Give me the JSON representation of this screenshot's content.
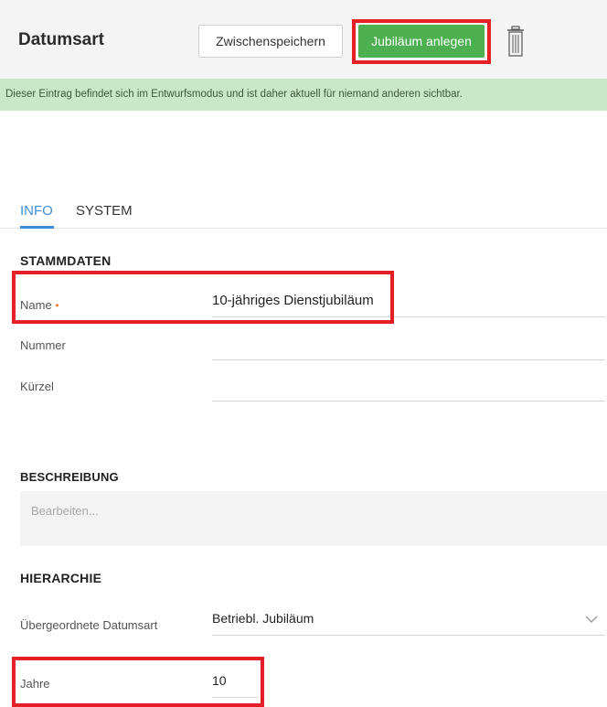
{
  "header": {
    "title": "Datumsart",
    "save_label": "Zwischenspeichern",
    "create_label": "Jubiläum anlegen",
    "trash_icon": "trash-icon"
  },
  "banner": {
    "text": "Dieser Eintrag befindet sich im Entwurfsmodus und ist daher aktuell für niemand anderen sichtbar."
  },
  "tabs": [
    {
      "label": "INFO",
      "active": true
    },
    {
      "label": "SYSTEM",
      "active": false
    }
  ],
  "stammdaten": {
    "title": "STAMMDATEN",
    "name_label": "Name",
    "name_required_marker": "•",
    "name_value": "10-jähriges Dienstjubiläum",
    "nummer_label": "Nummer",
    "nummer_value": "",
    "kuerzel_label": "Kürzel",
    "kuerzel_value": ""
  },
  "beschreibung": {
    "title": "BESCHREIBUNG",
    "placeholder": "Bearbeiten..."
  },
  "hierarchie": {
    "title": "HIERARCHIE",
    "parent_label": "Übergeordnete Datumsart",
    "parent_value": "Betriebl. Jubiläum",
    "jahre_label": "Jahre",
    "jahre_value": "10"
  },
  "colors": {
    "primary_button": "#4cb050",
    "highlight": "#e41f26",
    "tab_active": "#3f8fd8",
    "banner_bg": "#c9e8c8",
    "required": "#f0803c"
  }
}
